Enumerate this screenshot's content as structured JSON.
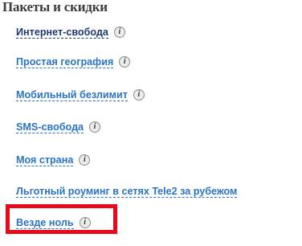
{
  "section": {
    "title": "Пакеты и скидки"
  },
  "colors": {
    "link_active": "#1d3a70",
    "link": "#2a74c4",
    "highlight": "#e8091b"
  },
  "packages": [
    {
      "label": "Интернет-свобода",
      "info_icon": "info-icon",
      "info_glyph": "i"
    },
    {
      "label": "Простая география",
      "info_icon": "info-icon",
      "info_glyph": "i"
    },
    {
      "label": "Мобильный безлимит",
      "info_icon": "info-icon",
      "info_glyph": "i"
    },
    {
      "label": "SMS-свобода",
      "info_icon": "info-icon",
      "info_glyph": "i"
    },
    {
      "label": "Моя страна",
      "info_icon": "info-icon",
      "info_glyph": "i"
    },
    {
      "label": "Льготный роуминг в сетях Tele2 за рубежом"
    },
    {
      "label": "Везде ноль",
      "info_icon": "info-icon",
      "info_glyph": "i"
    }
  ]
}
